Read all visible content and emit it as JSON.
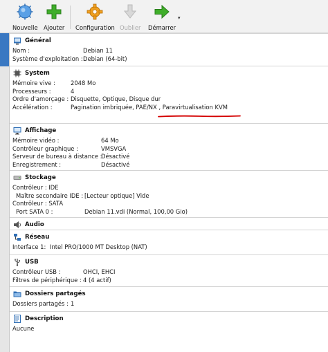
{
  "toolbar": {
    "new_label": "Nouvelle",
    "add_label": "Ajouter",
    "settings_label": "Configuration",
    "discard_label": "Oublier",
    "start_label": "Démarrer"
  },
  "general": {
    "title": "Général",
    "name_label": "Nom :",
    "name_value": "Debian 11",
    "os_label": "Système d'exploitation :",
    "os_value": "Debian (64-bit)"
  },
  "system": {
    "title": "System",
    "memory_label": "Mémoire vive :",
    "memory_value": "2048 Mo",
    "cpu_label": "Processeurs :",
    "cpu_value": "4",
    "boot_label": "Ordre d'amorçage :",
    "boot_value": "Disquette, Optique, Disque dur",
    "accel_label": "Accélération :",
    "accel_value_a": "Pagination imbriquée, PAE/NX ,",
    "accel_value_b": "Paravirtualisation KVM"
  },
  "display": {
    "title": "Affichage",
    "vram_label": "Mémoire vidéo :",
    "vram_value": "64 Mo",
    "controller_label": "Contrôleur graphique :",
    "controller_value": "VMSVGA",
    "rdp_label": "Serveur de bureau à distance :",
    "rdp_value": "Désactivé",
    "recording_label": "Enregistrement :",
    "recording_value": "Désactivé"
  },
  "storage": {
    "title": "Stockage",
    "ide_label": "Contrôleur : IDE",
    "ide_slave_label": "Maître secondaire IDE :",
    "ide_slave_value": "[Lecteur optique] Vide",
    "sata_label": "Contrôleur : SATA",
    "sata_port_label": "Port SATA 0 :",
    "sata_port_value": "Debian 11.vdi (Normal, 100,00 Gio)"
  },
  "audio": {
    "title": "Audio"
  },
  "network": {
    "title": "Réseau",
    "iface_label": "Interface 1:",
    "iface_value": "Intel PRO/1000 MT Desktop (NAT)"
  },
  "usb": {
    "title": "USB",
    "controller_label": "Contrôleur USB :",
    "controller_value": "OHCI, EHCI",
    "filters_label": "Filtres de périphérique :",
    "filters_value": "4 (4 actif)"
  },
  "shared": {
    "title": "Dossiers partagés",
    "count_label": "Dossiers partagés :",
    "count_value": "1"
  },
  "description": {
    "title": "Description",
    "value": "Aucune"
  },
  "colors": {
    "accent": "#3a78c2",
    "underline": "#d40000",
    "new_icon": "#5aa0e6",
    "add_icon": "#3fae2a",
    "settings_icon": "#f0a020",
    "start_icon": "#3fae2a"
  }
}
